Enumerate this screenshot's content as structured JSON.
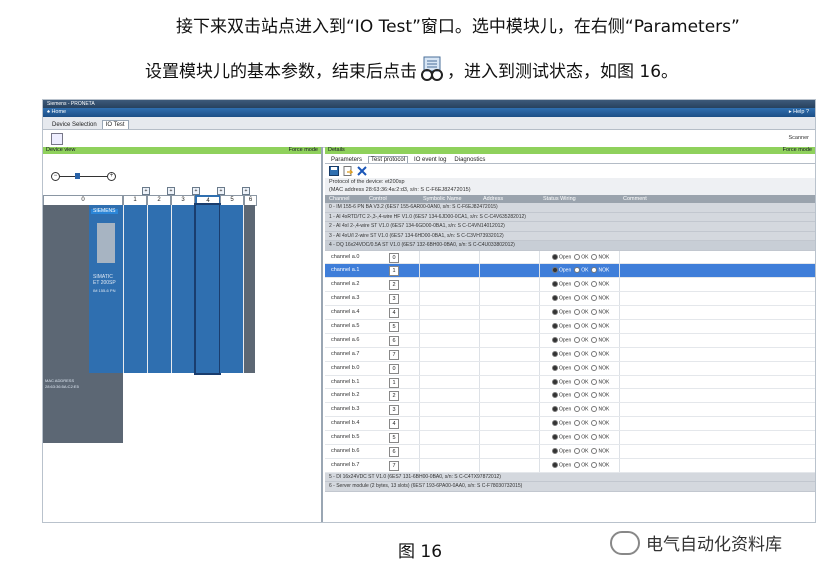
{
  "doc": {
    "line1": "接下来双击站点进入到“IO Test”窗口。选中模块儿，在右侧“Parameters”",
    "line2_before": "设置模块儿的基本参数，结束后点击",
    "line2_after": "，进入到测试状态，如图 16。",
    "caption": "图 16",
    "watermark": "电气自动化资料库"
  },
  "app": {
    "title": "Siemens - PRONETA",
    "home": "♠ Home",
    "help": "▸ Help ?",
    "tabs": [
      "Device Selection",
      "IO Test"
    ],
    "active_tab": "IO Test",
    "scanner": "Scanner"
  },
  "left": {
    "header": "Device view",
    "force": "Force mode",
    "slots": [
      "0",
      "1",
      "2",
      "3",
      "4",
      "5",
      "6"
    ],
    "brand": "SIEMENS",
    "cpu_name": "SIMATIC",
    "cpu_model": "ET 200SP",
    "cpu_order": "IM 155-6 PN",
    "mac_label": "MAC ADDRESS",
    "mac_value": "28:63:36:5A:C2:E5"
  },
  "right": {
    "header": "Details",
    "force": "Force mode",
    "subtabs": [
      "Parameters",
      "Test protocol",
      "IO event log",
      "Diagnostics"
    ],
    "active_subtab": "Test protocol",
    "protocol_title": "Protocol of the device: et200sp",
    "protocol_mac": "(MAC address 28:63:36:4a:2:d3, s/n: S C-F6EJ82472015)",
    "columns": [
      "Channel",
      "Control",
      "Symbolic Name",
      "Address",
      "Status Wiring",
      "Comment"
    ],
    "groups_top": [
      "0 - IM 155-6 PN BA V3.2 (6ES7 155-6AR00-0AN0, s/n: S C-F6EJ82472015)",
      "1 - AI 4xRTD/TC 2-,3-,4-wire HF V1.0 (6ES7 134-6JD00-0CA1, s/n: S C-C4V635282012)",
      "2 - AI 4xI 2-,4-wire ST V1.0 (6ES7 134-6GD00-0BA1, s/n: S C-C4VN14012012)",
      "3 - AI 4xU/I 2-wire ST V1.0 (6ES7 134-6HD00-0BA1, s/n: S C-C3VH73932012)",
      "4 - DQ 16x24VDC/0.5A ST V1.0 (6ES7 132-6BH00-0BA0, s/n: S C-C4U033802012)"
    ],
    "channels": [
      {
        "name": "channel a.0",
        "val": "0"
      },
      {
        "name": "channel a.1",
        "val": "1"
      },
      {
        "name": "channel a.2",
        "val": "2"
      },
      {
        "name": "channel a.3",
        "val": "3"
      },
      {
        "name": "channel a.4",
        "val": "4"
      },
      {
        "name": "channel a.5",
        "val": "5"
      },
      {
        "name": "channel a.6",
        "val": "6"
      },
      {
        "name": "channel a.7",
        "val": "7"
      },
      {
        "name": "channel b.0",
        "val": "0"
      },
      {
        "name": "channel b.1",
        "val": "1"
      },
      {
        "name": "channel b.2",
        "val": "2"
      },
      {
        "name": "channel b.3",
        "val": "3"
      },
      {
        "name": "channel b.4",
        "val": "4"
      },
      {
        "name": "channel b.5",
        "val": "5"
      },
      {
        "name": "channel b.6",
        "val": "6"
      },
      {
        "name": "channel b.7",
        "val": "7"
      }
    ],
    "selected_channel": 1,
    "radio_labels": [
      "Open",
      "OK",
      "NOK"
    ],
    "groups_bottom": [
      "5 - DI 16x24VDC ST V1.0 (6ES7 131-6BH00-0BA0, s/n: S C-C4TX97872012)",
      "6 - Server module (2 bytes, 13 slots) (6ES7 193-6PA00-0AA0, s/n: S C-F78030732015)"
    ]
  },
  "colors": {
    "accent": "#2f6fb0",
    "green": "#8fd15c",
    "selection": "#3f7ed9"
  }
}
